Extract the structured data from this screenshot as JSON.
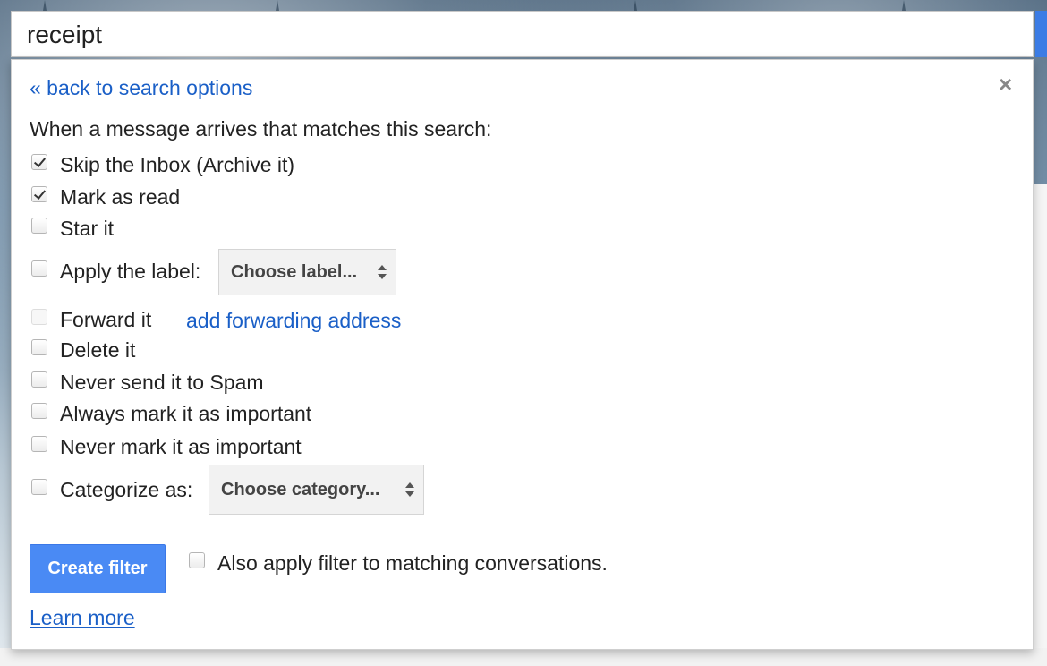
{
  "search": {
    "value": "receipt"
  },
  "panel": {
    "back_link": "« back to search options",
    "close_icon": "×",
    "intro": "When a message arrives that matches this search:",
    "options": [
      {
        "label": "Skip the Inbox (Archive it)",
        "checked": true
      },
      {
        "label": "Mark as read",
        "checked": true
      },
      {
        "label": "Star it",
        "checked": false
      },
      {
        "label": "Apply the label:",
        "checked": false
      },
      {
        "label": "Forward it",
        "checked": false,
        "disabled": true
      },
      {
        "label": "Delete it",
        "checked": false
      },
      {
        "label": "Never send it to Spam",
        "checked": false
      },
      {
        "label": "Always mark it as important",
        "checked": false
      },
      {
        "label": "Never mark it as important",
        "checked": false
      },
      {
        "label": "Categorize as:",
        "checked": false
      }
    ],
    "label_select": "Choose label...",
    "forward_link": "add forwarding address",
    "category_select": "Choose category...",
    "create_button": "Create filter",
    "also_apply": "Also apply filter to matching conversations.",
    "learn_more": "Learn more"
  },
  "colors": {
    "link": "#1a5fc7",
    "button": "#4a8af4"
  }
}
